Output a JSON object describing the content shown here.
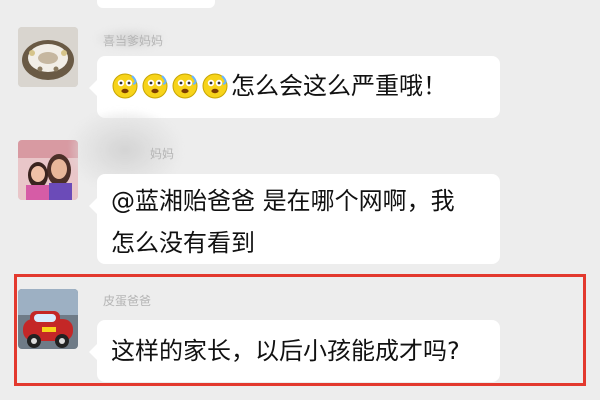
{
  "chat": {
    "messages": [
      {
        "sender": "喜当爹妈妈",
        "text": "怎么会这么严重哦！",
        "emoji": [
          "sweat-face-icon",
          "sweat-face-icon",
          "sweat-face-icon",
          "sweat-face-icon"
        ]
      },
      {
        "sender": "妈妈",
        "line1": "@蓝湘贻爸爸  是在哪个网啊，我",
        "line2": "怎么没有看到"
      },
      {
        "sender": "皮蛋爸爸",
        "text": "这样的家长，以后小孩能成才吗?"
      }
    ]
  },
  "colors": {
    "background": "#ededed",
    "bubble": "#ffffff",
    "highlight": "#e3392e",
    "sender": "#b5b5b5"
  }
}
